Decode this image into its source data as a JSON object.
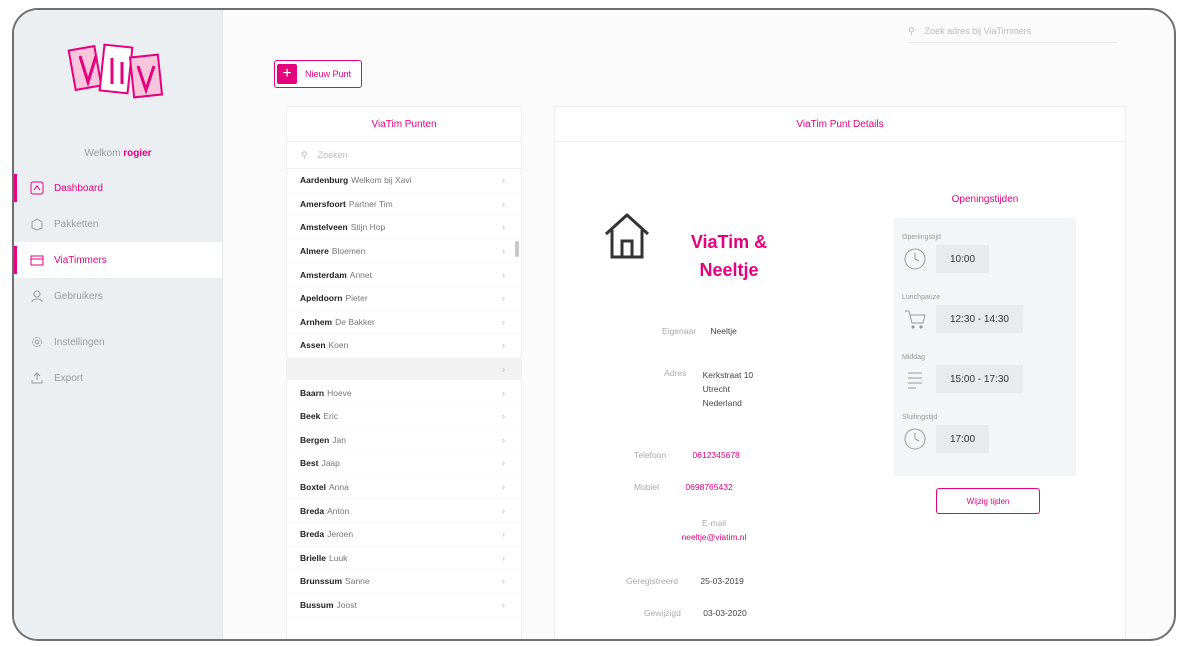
{
  "sidebar": {
    "welcome_prefix": "Welkom",
    "welcome_user": "rogier",
    "items": [
      {
        "label": "Dashboard",
        "icon": "dashboard-icon"
      },
      {
        "label": "Pakketten",
        "icon": "package-icon"
      },
      {
        "label": "ViaTimmers",
        "icon": "store-icon"
      },
      {
        "label": "Gebruikers",
        "icon": "users-icon"
      },
      {
        "label": "Instellingen",
        "icon": "gear-icon"
      },
      {
        "label": "Export",
        "icon": "export-icon"
      }
    ]
  },
  "topbar": {
    "search_placeholder": "Zoek adres bij ViaTimmers"
  },
  "toolbar": {
    "add_label": "Nieuw Punt"
  },
  "list_panel": {
    "title": "ViaTim Punten",
    "search_placeholder": "Zoeken",
    "rows": [
      {
        "bold": "Aardenburg",
        "rest": "Welkom bij Xavi"
      },
      {
        "bold": "Amersfoort",
        "rest": "Partner Tim"
      },
      {
        "bold": "Amstelveen",
        "rest": "Stijn Hop"
      },
      {
        "bold": "Almere",
        "rest": "Bloemen"
      },
      {
        "bold": "Amsterdam",
        "rest": "Annet"
      },
      {
        "bold": "Apeldoorn",
        "rest": "Pieter"
      },
      {
        "bold": "Arnhem",
        "rest": "De Bakker"
      },
      {
        "bold": "Assen",
        "rest": "Koen"
      },
      {
        "bold": "",
        "rest": ""
      },
      {
        "bold": "Baarn",
        "rest": "Hoeve"
      },
      {
        "bold": "Beek",
        "rest": "Eric"
      },
      {
        "bold": "Bergen",
        "rest": "Jan"
      },
      {
        "bold": "Best",
        "rest": "Jaap"
      },
      {
        "bold": "Boxtel",
        "rest": "Anna"
      },
      {
        "bold": "Breda",
        "rest": "Anton"
      },
      {
        "bold": "Breda",
        "rest": "Jeroen"
      },
      {
        "bold": "Brielle",
        "rest": "Luuk"
      },
      {
        "bold": "Brunssum",
        "rest": "Sanne"
      },
      {
        "bold": "Bussum",
        "rest": "Joost"
      }
    ]
  },
  "detail_panel": {
    "title": "ViaTim Punt Details",
    "name": "ViaTim & Neeltje",
    "fields": {
      "owner_label": "Eigenaar",
      "owner_value": "Neeltje",
      "address_label": "Adres",
      "address_lines": [
        "Kerkstraat 10",
        "Utrecht",
        "Nederland"
      ],
      "phone_label": "Telefoon",
      "phone_value": "0612345678",
      "mobile_label": "Mobiel",
      "mobile_value": "0698765432",
      "email_label": "E-mail",
      "email_value": "neeltje@viatim.nl",
      "registered_label": "Geregistreerd",
      "registered_value": "25-03-2019",
      "updated_label": "Gewijzigd",
      "updated_value": "03-03-2020"
    },
    "hours": {
      "title": "Openingstijden",
      "blocks": [
        {
          "label": "Openingstijd",
          "time": "10:00",
          "icon": "clock-icon"
        },
        {
          "label": "Lunchpauze",
          "time": "12:30 - 14:30",
          "icon": "cart-icon"
        },
        {
          "label": "Middag",
          "time": "15:00 - 17:30",
          "icon": "list-icon"
        },
        {
          "label": "Sluitingstijd",
          "time": "17:00",
          "icon": "clock-icon"
        }
      ],
      "button_label": "Wijzig tijden"
    }
  },
  "colors": {
    "accent": "#e5007d",
    "sidebar": "#eceff2"
  }
}
